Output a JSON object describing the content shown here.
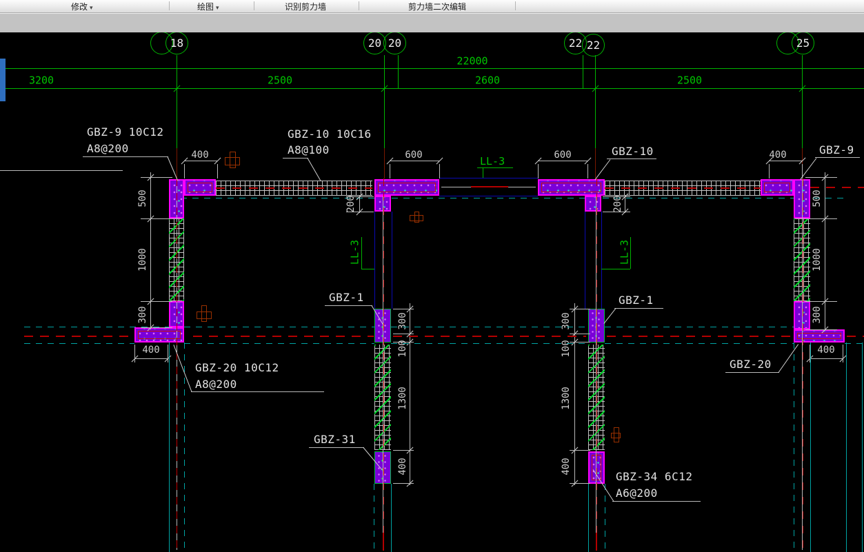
{
  "toolbar": {
    "items": [
      {
        "label": "修改",
        "arrow": "▾"
      },
      {
        "label": "绘图",
        "arrow": "▾"
      },
      {
        "label": "识别剪力墙"
      },
      {
        "label": "剪力墙二次编辑"
      }
    ]
  },
  "grid": {
    "bubbles": [
      "18",
      "20",
      "20",
      "22",
      "22",
      "25"
    ],
    "overall": "22000",
    "segments": [
      "3200",
      "2500",
      "2600",
      "2500"
    ]
  },
  "dims": {
    "t400_18": "400",
    "t600_20": "600",
    "t600_22": "600",
    "t400_25": "400",
    "l500": "500",
    "l1000": "1000",
    "l300": "300",
    "l400": "400",
    "r500": "500",
    "r1000": "1000",
    "r300": "300",
    "r400": "400",
    "cl300": "300",
    "cl100": "100",
    "cl1300": "1300",
    "cl400": "400",
    "cr300": "300",
    "cr100": "100",
    "cr1300": "1300",
    "cr400": "400",
    "stem200_l": "200",
    "stem200_r": "200"
  },
  "labels": {
    "gbz9_line1": "GBZ-9 10C12",
    "gbz9_line2": "A8@200",
    "gbz10_line1": "GBZ-10 10C16",
    "gbz10_line2": "A8@100",
    "gbz10_r": "GBZ-10",
    "gbz9_r": "GBZ-9",
    "gbz1_l": "GBZ-1",
    "gbz1_r": "GBZ-1",
    "gbz20_line1": "GBZ-20 10C12",
    "gbz20_line2": "A8@200",
    "gbz31": "GBZ-31",
    "gbz34_line1": "GBZ-34 6C12",
    "gbz34_line2": "A6@200",
    "gbz20_r": "GBZ-20",
    "ll3_top": "LL-3",
    "ll3_left": "LL-3",
    "ll3_right": "LL-3"
  },
  "colors": {
    "grid_green": "#00b400",
    "dim_white": "#cdcdcd",
    "column_magenta": "#ff00ff",
    "column_fill": "#7a00d8",
    "highlight_green": "#00c040",
    "beam_navy": "#0a0ab4",
    "centerline_red": "#b40000",
    "wall_cyan": "#00a4a4"
  }
}
